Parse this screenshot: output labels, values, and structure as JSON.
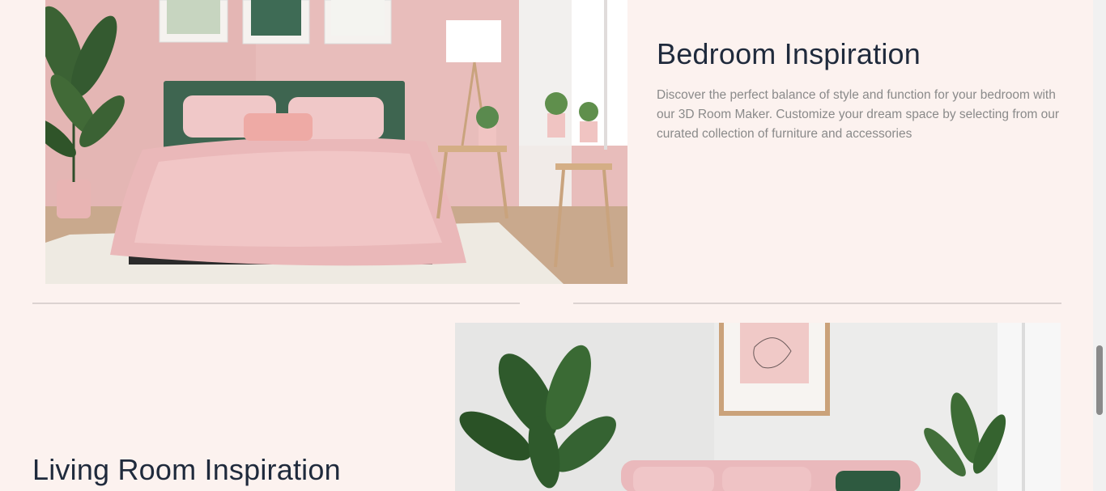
{
  "bedroom": {
    "title": "Bedroom Inspiration",
    "description": "Discover the perfect balance of style and function for your bedroom with our 3D Room Maker. Customize your dream space by selecting from our curated collection of furniture and accessories",
    "image_alt": "Pink bedroom with green headboard"
  },
  "living_room": {
    "title": "Living Room Inspiration",
    "image_alt": "Living room with pink sofa and plants"
  },
  "colors": {
    "background": "#fcf2ef",
    "heading": "#1f2a3c",
    "body_text": "#8a8a8a",
    "divider": "#dcd3d1"
  }
}
